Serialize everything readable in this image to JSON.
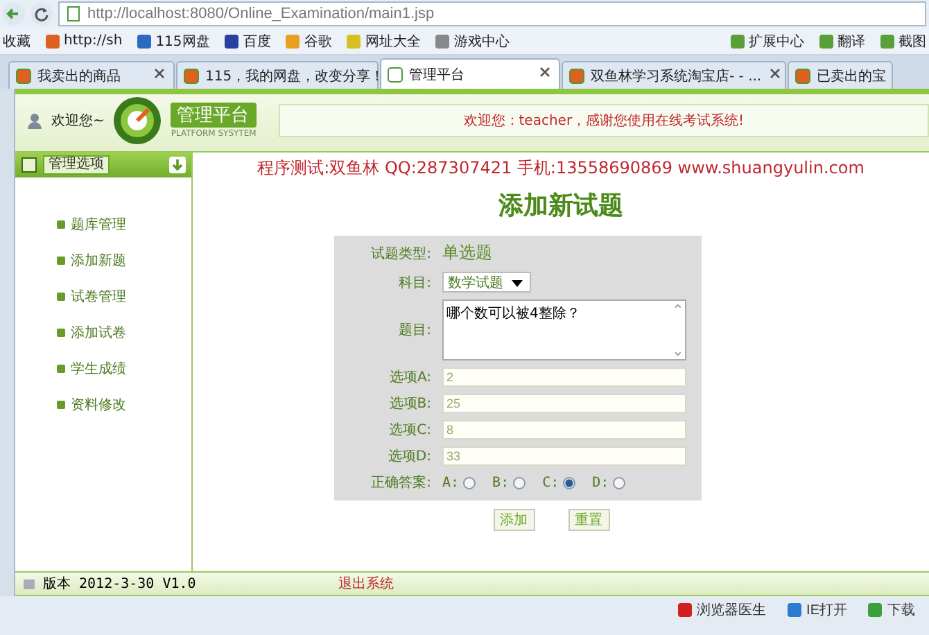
{
  "browser": {
    "address": "http://localhost:8080/Online_Examination/main1.jsp",
    "bookmarks": [
      "收藏",
      "http://sh",
      "115网盘",
      "百度",
      "谷歌",
      "网址大全",
      "游戏中心"
    ],
    "tools": [
      "扩展中心",
      "翻译",
      "截图"
    ],
    "tabs": [
      {
        "label": "我卖出的商品",
        "selected": false
      },
      {
        "label": "115，我的网盘，改变分享！",
        "selected": false
      },
      {
        "label": "管理平台",
        "selected": true
      },
      {
        "label": "双鱼林学习系统淘宝店- - ...",
        "selected": false
      },
      {
        "label": "已卖出的宝",
        "selected": false
      }
    ]
  },
  "header": {
    "greeting": "欢迎您~",
    "logo_title": "管理平台",
    "logo_subtitle": "PLATFORM SYSYTEM",
    "message": "欢迎您：teacher，感谢您使用在线考试系统!"
  },
  "sidebar": {
    "title": "管理选项",
    "items": [
      "题库管理",
      "添加新题",
      "试卷管理",
      "添加试卷",
      "学生成绩",
      "资料修改"
    ]
  },
  "content": {
    "notice": "程序测试:双鱼林 QQ:287307421 手机:13558690869 www.shuangyulin.com",
    "heading": "添加新试题",
    "form": {
      "type_label": "试题类型:",
      "type_value": "单选题",
      "subject_label": "科目:",
      "subject_value": "数学试题",
      "question_label": "题目:",
      "question_value": "哪个数可以被4整除？",
      "options": [
        {
          "label": "选项A:",
          "value": "2"
        },
        {
          "label": "选项B:",
          "value": "25"
        },
        {
          "label": "选项C:",
          "value": "8"
        },
        {
          "label": "选项D:",
          "value": "33"
        }
      ],
      "answer_label": "正确答案:",
      "answers": [
        {
          "label": "A:",
          "selected": false
        },
        {
          "label": "B:",
          "selected": false
        },
        {
          "label": "C:",
          "selected": true
        },
        {
          "label": "D:",
          "selected": false
        }
      ],
      "buttons": [
        "添加",
        "重置"
      ]
    }
  },
  "footer": {
    "version": "版本 2012-3-30 V1.0",
    "logout": "退出系统"
  },
  "status_bar": {
    "items": [
      "浏览器医生",
      "IE打开",
      "下载"
    ]
  }
}
